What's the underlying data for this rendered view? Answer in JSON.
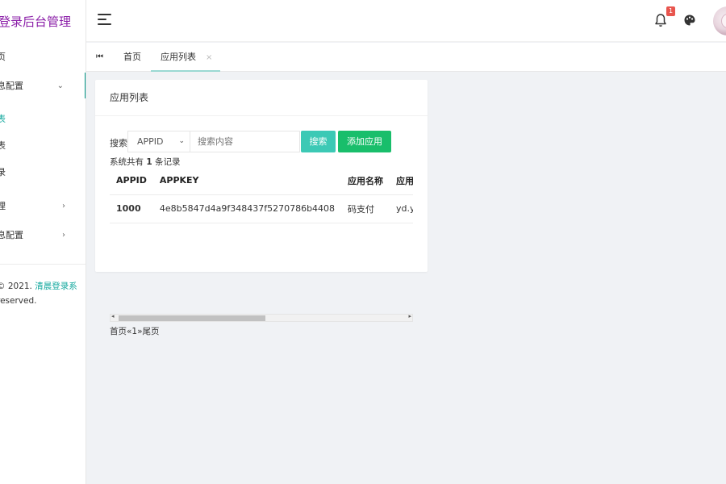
{
  "sidebar": {
    "brand": "登录后台管理",
    "items": [
      {
        "label": "页",
        "chevron": ""
      },
      {
        "label": "息配置",
        "chevron": "⌄"
      },
      {
        "label": "表",
        "chevron": ""
      },
      {
        "label": "表",
        "chevron": ""
      },
      {
        "label": "录",
        "chevron": ""
      },
      {
        "label": "理",
        "chevron": "›"
      },
      {
        "label": "息配置",
        "chevron": "›"
      }
    ],
    "copyright_prefix": "© 2021. ",
    "copyright_link": "清晨登录系",
    "copyright_line2": "reserved."
  },
  "header": {
    "notification_count": "1",
    "accent_color": "#009688"
  },
  "tabs": {
    "nav_icon": "⏮",
    "home": "首页",
    "current": "应用列表",
    "close": "×"
  },
  "card": {
    "title": "应用列表",
    "search_label": "搜索",
    "select_value": "APPID",
    "select_caret": "⌄",
    "search_placeholder": "搜索内容",
    "search_button": "搜索",
    "add_button": "添加应用",
    "record_prefix": "系统共有 ",
    "record_count": "1",
    "record_suffix": " 条记录",
    "table": {
      "headers": [
        "APPID",
        "APPKEY",
        "应用名称",
        "应用域名"
      ],
      "rows": [
        [
          "1000",
          "4e8b5847d4a9f348437f5270786b4408",
          "码支付",
          "yd.ylcom"
        ]
      ]
    },
    "scroll_left": "◂",
    "scroll_right": "▸",
    "pager": "首页«1»尾页"
  }
}
